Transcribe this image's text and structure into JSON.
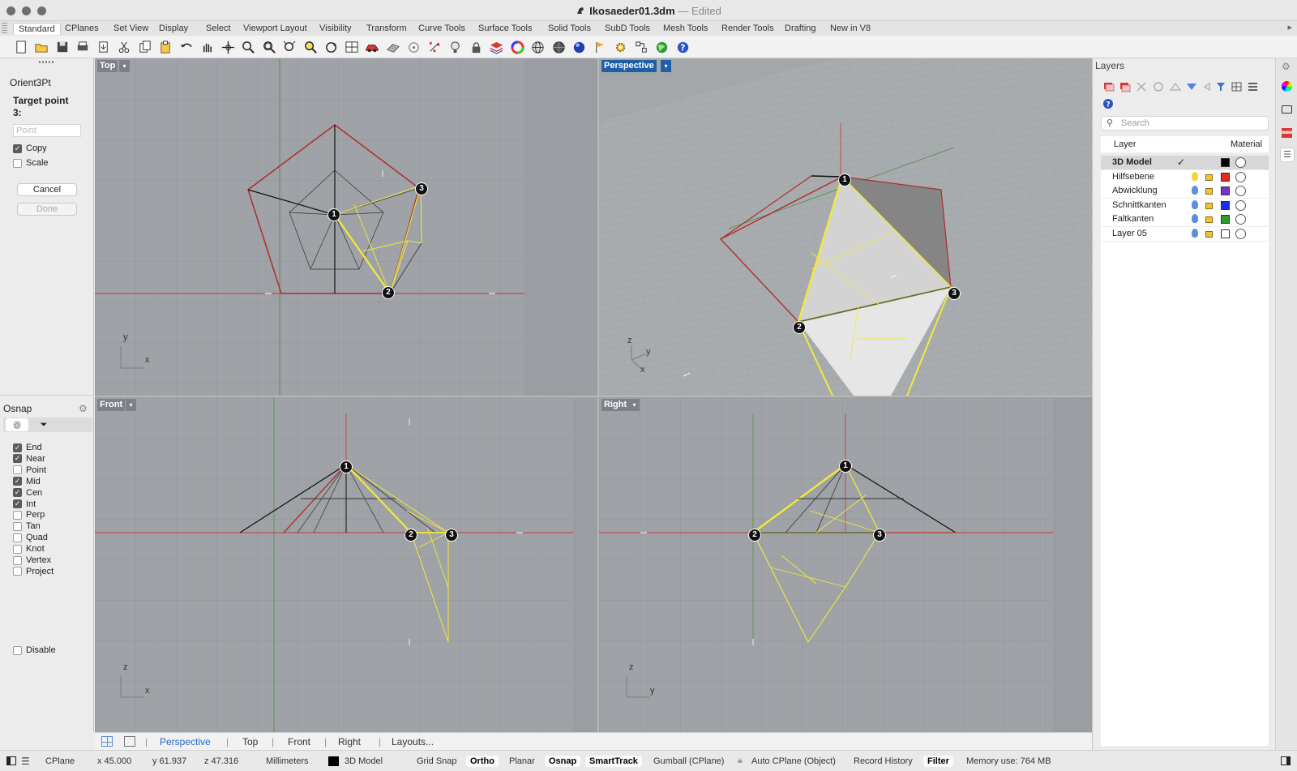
{
  "window": {
    "title": "Ikosaeder01.3dm",
    "separator": "—",
    "edited": "Edited"
  },
  "toolbar_tabs": [
    "Standard",
    "CPlanes",
    "Set View",
    "Display",
    "Select",
    "Viewport Layout",
    "Visibility",
    "Transform",
    "Curve Tools",
    "Surface Tools",
    "Solid Tools",
    "SubD Tools",
    "Mesh Tools",
    "Render Tools",
    "Drafting",
    "New in V8"
  ],
  "active_tab": "Standard",
  "toolbar_icons": [
    "new-icon",
    "open-icon",
    "save-icon",
    "print-icon",
    "import-icon",
    "cut-icon",
    "copy-icon",
    "paste-icon",
    "undo-icon",
    "pan-icon",
    "rotate-view-icon",
    "zoom-icon",
    "zoom-window-icon",
    "zoom-extents-icon",
    "zoom-selected-icon",
    "rotate-3d-icon",
    "four-viewports-icon",
    "car-icon",
    "grid-icon",
    "circle-target-icon",
    "points-icon",
    "light-bulb-icon",
    "lock-icon",
    "layers-icon",
    "color-wheel-icon",
    "sphere-wire-icon",
    "render-sphere-icon",
    "blue-sphere-icon",
    "flag-icon",
    "gear-options-icon",
    "snap-grid-icon",
    "globe-icon",
    "help-icon"
  ],
  "command_panel": {
    "command": "Orient3Pt",
    "prompt": "Target point 3:",
    "input_placeholder": "Point",
    "options": [
      {
        "label": "Copy",
        "checked": true
      },
      {
        "label": "Scale",
        "checked": false
      }
    ],
    "cancel": "Cancel",
    "done": "Done"
  },
  "osnap": {
    "title": "Osnap",
    "items": [
      {
        "label": "End",
        "checked": true
      },
      {
        "label": "Near",
        "checked": true
      },
      {
        "label": "Point",
        "checked": false
      },
      {
        "label": "Mid",
        "checked": true
      },
      {
        "label": "Cen",
        "checked": true
      },
      {
        "label": "Int",
        "checked": true
      },
      {
        "label": "Perp",
        "checked": false
      },
      {
        "label": "Tan",
        "checked": false
      },
      {
        "label": "Quad",
        "checked": false
      },
      {
        "label": "Knot",
        "checked": false
      },
      {
        "label": "Vertex",
        "checked": false
      },
      {
        "label": "Project",
        "checked": false
      }
    ],
    "disable": "Disable"
  },
  "viewports": {
    "top": {
      "label": "Top",
      "axis_a": "y",
      "axis_b": "x"
    },
    "perspective": {
      "label": "Perspective",
      "axis_a": "z",
      "axis_b": "y",
      "axis_c": "x"
    },
    "front": {
      "label": "Front",
      "axis_a": "z",
      "axis_b": "x"
    },
    "right": {
      "label": "Right",
      "axis_a": "z",
      "axis_b": "y"
    },
    "point_labels": [
      "1",
      "2",
      "3"
    ]
  },
  "viewport_tabs": [
    "Perspective",
    "Top",
    "Front",
    "Right",
    "Layouts..."
  ],
  "active_viewport_tab": "Perspective",
  "layers": {
    "title": "Layers",
    "search_placeholder": "Search",
    "col_layer": "Layer",
    "col_material": "Material",
    "rows": [
      {
        "name": "3D Model",
        "current": true,
        "color": "#000000"
      },
      {
        "name": "Hilfsebene",
        "current": false,
        "color": "#e8271d"
      },
      {
        "name": "Abwicklung",
        "current": false,
        "color": "#7a2fd0"
      },
      {
        "name": "Schnittkanten",
        "current": false,
        "color": "#1a2ff0"
      },
      {
        "name": "Faltkanten",
        "current": false,
        "color": "#2e9a2e"
      },
      {
        "name": "Layer 05",
        "current": false,
        "color": "#ffffff"
      }
    ],
    "current_mark": "✓"
  },
  "statusbar": {
    "cplane": "CPlane",
    "x": "x 45.000",
    "y": "y 61.937",
    "z": "z 47.316",
    "units": "Millimeters",
    "layer": "3D Model",
    "grid_snap": "Grid Snap",
    "ortho": "Ortho",
    "planar": "Planar",
    "osnap": "Osnap",
    "smarttrack": "SmartTrack",
    "gumball": "Gumball (CPlane)",
    "auto_cplane": "Auto CPlane (Object)",
    "record_history": "Record History",
    "filter": "Filter",
    "memory": "Memory use: 764 MB"
  },
  "colors": {
    "red_edge": "#c8312b",
    "yellow_edge": "#f1ea3a",
    "black_edge": "#111111",
    "viewport_bg": "#9ea1a5",
    "active_blue": "#1f5fa8"
  }
}
